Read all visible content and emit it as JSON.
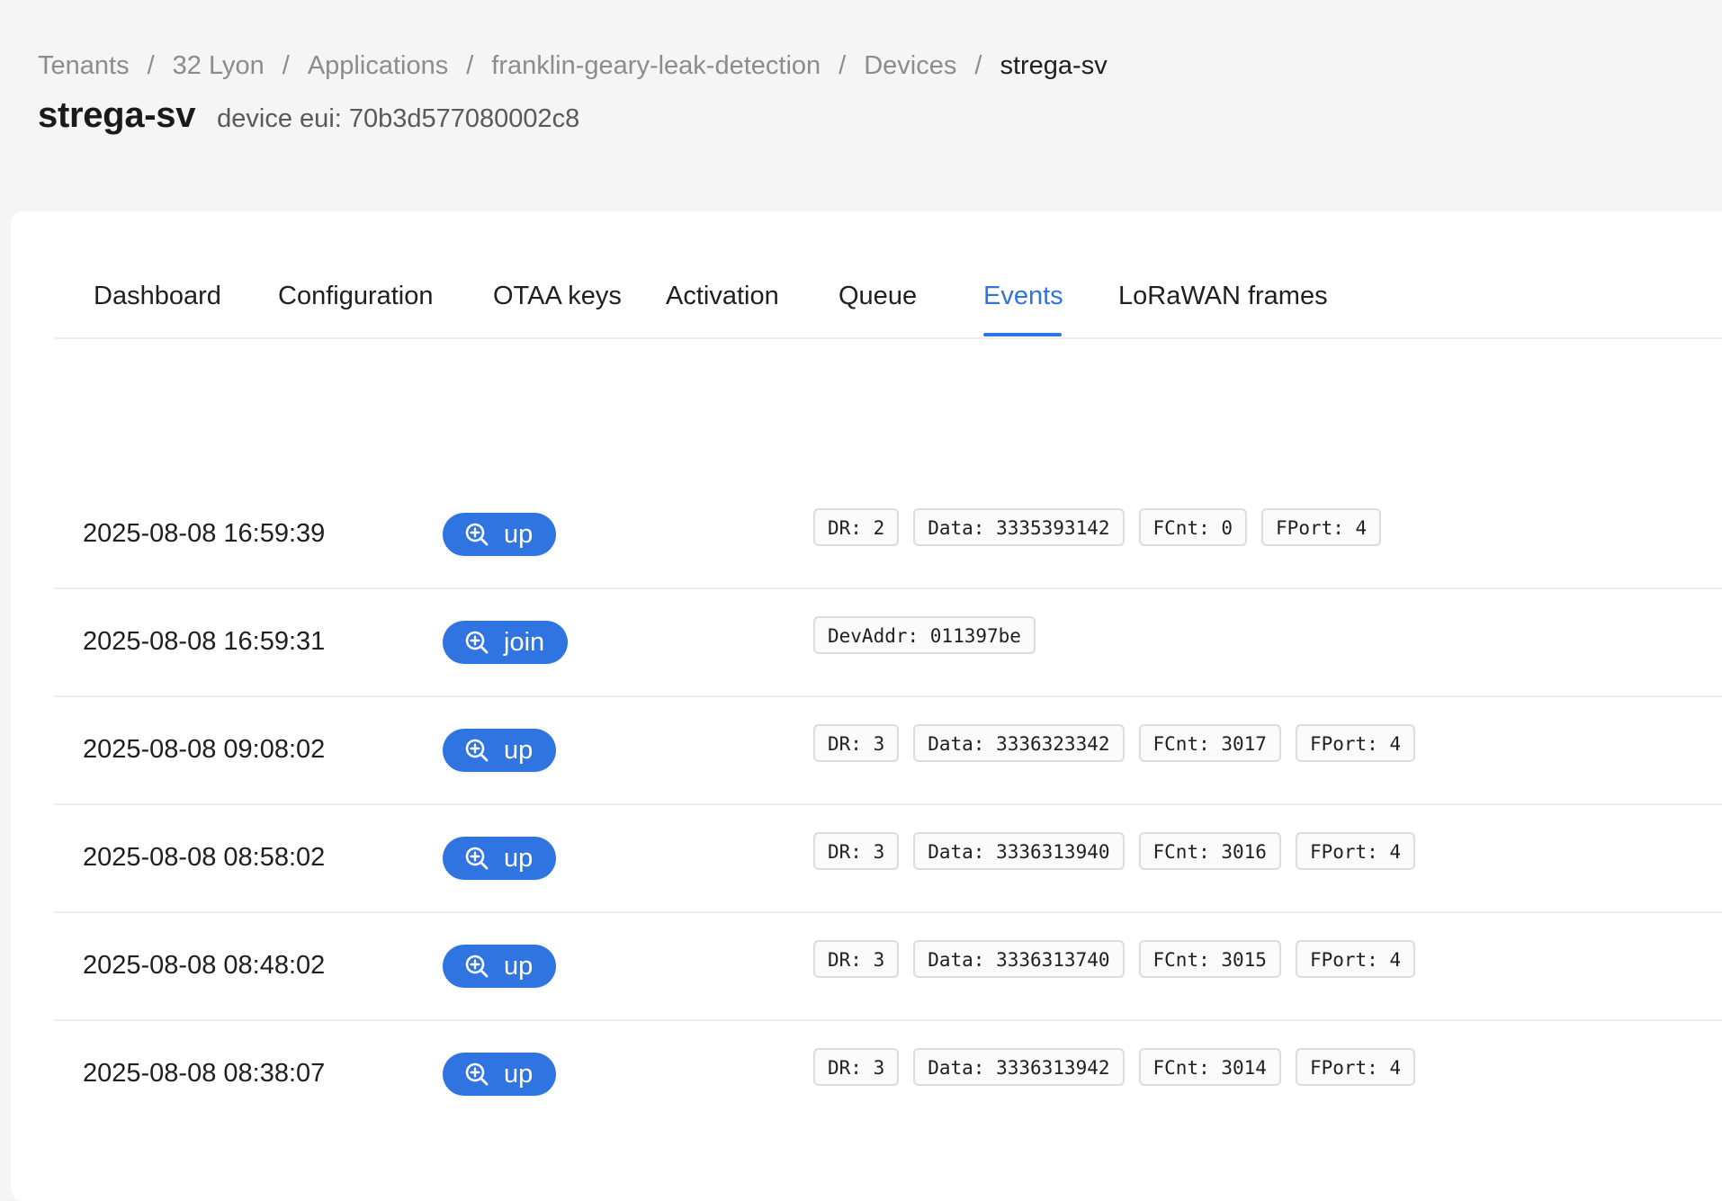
{
  "breadcrumb": {
    "items": [
      "Tenants",
      "32 Lyon",
      "Applications",
      "franklin-geary-leak-detection",
      "Devices"
    ],
    "current": "strega-sv",
    "separator": "/"
  },
  "header": {
    "title": "strega-sv",
    "subtitle": "device eui: 70b3d577080002c8"
  },
  "tabs": [
    "Dashboard",
    "Configuration",
    "OTAA keys",
    "Activation",
    "Queue",
    "Events",
    "LoRaWAN frames"
  ],
  "active_tab": "Events",
  "colors": {
    "accent": "#2f74e0",
    "background": "#f5f5f5",
    "card": "#ffffff",
    "divider": "#ececec",
    "chip_border": "#dcdcdc"
  },
  "icons": {
    "event_tag": "zoom-in-icon"
  },
  "events": [
    {
      "time": "2025-08-08 16:59:39",
      "type": "up",
      "chips": [
        "DR: 2",
        "Data: 3335393142",
        "FCnt: 0",
        "FPort: 4"
      ]
    },
    {
      "time": "2025-08-08 16:59:31",
      "type": "join",
      "chips": [
        "DevAddr: 011397be"
      ]
    },
    {
      "time": "2025-08-08 09:08:02",
      "type": "up",
      "chips": [
        "DR: 3",
        "Data: 3336323342",
        "FCnt: 3017",
        "FPort: 4"
      ]
    },
    {
      "time": "2025-08-08 08:58:02",
      "type": "up",
      "chips": [
        "DR: 3",
        "Data: 3336313940",
        "FCnt: 3016",
        "FPort: 4"
      ]
    },
    {
      "time": "2025-08-08 08:48:02",
      "type": "up",
      "chips": [
        "DR: 3",
        "Data: 3336313740",
        "FCnt: 3015",
        "FPort: 4"
      ]
    },
    {
      "time": "2025-08-08 08:38:07",
      "type": "up",
      "chips": [
        "DR: 3",
        "Data: 3336313942",
        "FCnt: 3014",
        "FPort: 4"
      ]
    }
  ]
}
